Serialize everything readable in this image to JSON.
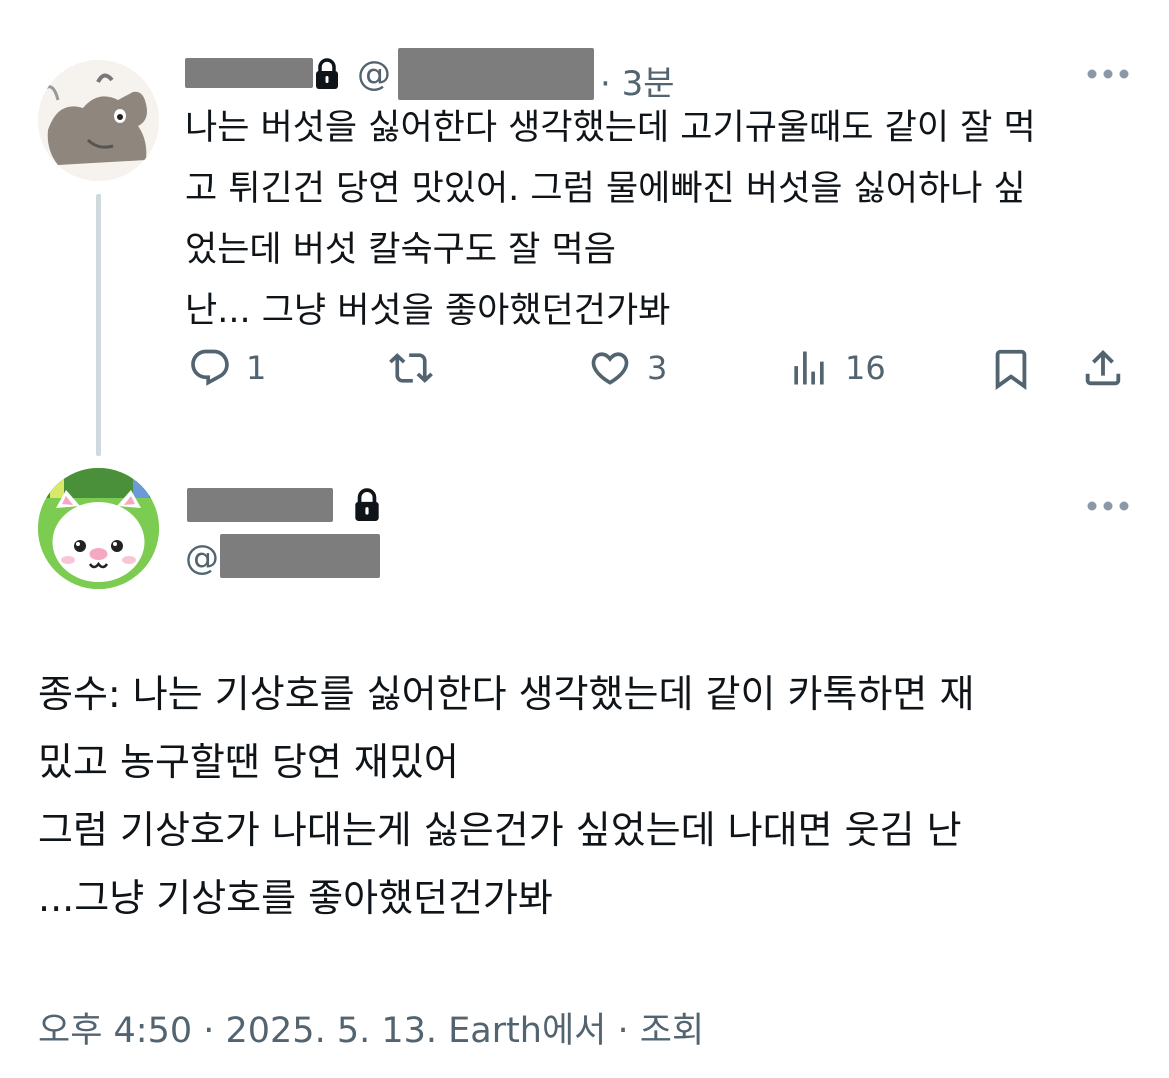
{
  "reply_tweet": {
    "handle_prefix": "@",
    "time": "· 3분",
    "text": "나는 버섯을 싫어한다 생각했는데 고기규울때도 같이 잘 먹\n고 튀긴건 당연 맛있어. 그럼 물에빠진 버섯을 싫어하나 싶\n었는데 버섯 칼숙구도 잘 먹음\n난... 그냥 버섯을 좋아했던건가봐",
    "actions": {
      "reply_count": "1",
      "like_count": "3",
      "views_count": "16"
    }
  },
  "main_tweet": {
    "handle_prefix": "@",
    "text": "종수: 나는 기상호를 싫어한다 생각했는데 같이 카톡하면 재\n밌고 농구할땐 당연 재밌어\n그럼 기상호가 나대는게 싫은건가 싶었는데 나대면 웃김 난\n...그냥 기상호를 좋아했던건가봐",
    "meta": "오후 4:50 · 2025. 5. 13. Earth에서 · 조회"
  },
  "colors": {
    "text": "#0f1419",
    "muted": "#536471",
    "thread_line": "#cfd9de",
    "redaction": "#7d7d7d"
  },
  "icons": [
    "goat-avatar",
    "cat-avatar",
    "lock-icon",
    "more-icon",
    "reply-icon",
    "retweet-icon",
    "like-icon",
    "views-icon",
    "bookmark-icon",
    "share-icon"
  ]
}
